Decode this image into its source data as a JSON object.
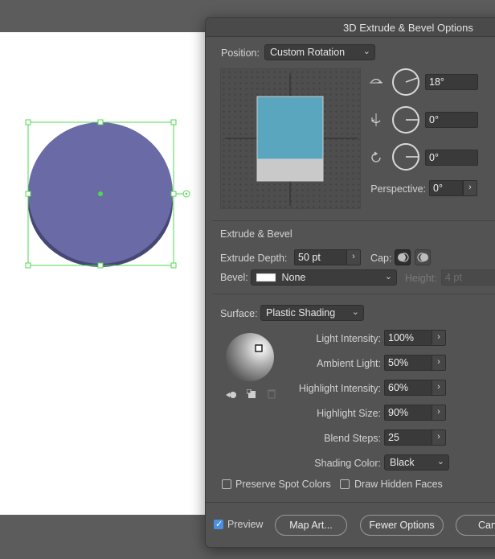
{
  "window": {
    "title": "3D Extrude & Bevel Options"
  },
  "position": {
    "label": "Position:",
    "value": "Custom Rotation",
    "rotations": [
      {
        "icon": "rotate-x-axis-icon",
        "value": "18°"
      },
      {
        "icon": "rotate-y-axis-icon",
        "value": "0°"
      },
      {
        "icon": "rotate-z-axis-icon",
        "value": "0°"
      }
    ],
    "perspective_label": "Perspective:",
    "perspective_value": "0°"
  },
  "extrude": {
    "section_title": "Extrude & Bevel",
    "depth_label": "Extrude Depth:",
    "depth_value": "50 pt",
    "cap_label": "Cap:",
    "bevel_label": "Bevel:",
    "bevel_value": "None",
    "height_label": "Height:",
    "height_value": "4 pt"
  },
  "surface": {
    "label": "Surface:",
    "value": "Plastic Shading",
    "rows": [
      {
        "label": "Light Intensity:",
        "value": "100%"
      },
      {
        "label": "Ambient Light:",
        "value": "50%"
      },
      {
        "label": "Highlight Intensity:",
        "value": "60%"
      },
      {
        "label": "Highlight Size:",
        "value": "90%"
      },
      {
        "label": "Blend Steps:",
        "value": "25"
      }
    ],
    "shading_color_label": "Shading Color:",
    "shading_color_value": "Black",
    "preserve_spot": "Preserve Spot Colors",
    "draw_hidden": "Draw Hidden Faces"
  },
  "footer": {
    "preview": "Preview",
    "map_art": "Map Art...",
    "fewer_options": "Fewer Options",
    "cancel": "Can"
  },
  "colors": {
    "accent": "#4a90e2",
    "object_fill": "#6a6aa6",
    "object_side": "#474775",
    "selection": "#4fd84f",
    "cube_face": "#5aa6bf"
  }
}
